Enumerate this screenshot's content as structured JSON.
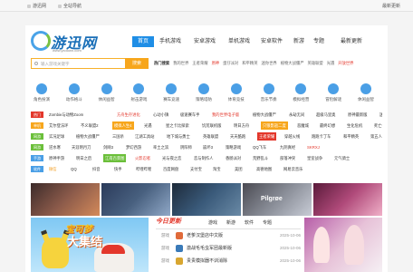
{
  "topbar": {
    "home": "游迅网",
    "nav": "全站导航",
    "fav": "最新更新"
  },
  "logo": {
    "name": "游迅网",
    "url": "www.yxdown.com"
  },
  "nav": [
    {
      "label": "首页",
      "active": true
    },
    {
      "label": "手机游戏"
    },
    {
      "label": "安卓游戏"
    },
    {
      "label": "单机游戏"
    },
    {
      "label": "安卓软件"
    },
    {
      "label": "新游"
    },
    {
      "label": "专题"
    },
    {
      "label": "最新更新"
    }
  ],
  "search": {
    "placeholder": "输入游戏关键字",
    "button": "搜索"
  },
  "hot_search": {
    "label": "热门搜索",
    "items": [
      "我的世界",
      "王者荣耀",
      "原神",
      "蛋仔派对",
      "和平精英",
      "迷你世界",
      "植物大战僵尸",
      "英雄联盟",
      "光遇",
      "开放世界"
    ],
    "highlight": [
      "原神",
      "开放世界"
    ]
  },
  "categories": [
    {
      "label": "角色扮演",
      "color": "#4a9fe6"
    },
    {
      "label": "动作格斗",
      "color": "#4a9fe6"
    },
    {
      "label": "休闲益智",
      "color": "#4a9fe6"
    },
    {
      "label": "射击游戏",
      "color": "#4a9fe6"
    },
    {
      "label": "赛车竞速",
      "color": "#4a9fe6"
    },
    {
      "label": "策略塔防",
      "color": "#4a9fe6"
    },
    {
      "label": "体育竞技",
      "color": "#4a9fe6"
    },
    {
      "label": "音乐节奏",
      "color": "#4a9fe6"
    },
    {
      "label": "模拟经营",
      "color": "#4a9fe6"
    },
    {
      "label": "冒险解谜",
      "color": "#4a9fe6"
    },
    {
      "label": "休闲益智",
      "color": "#4a9fe6"
    }
  ],
  "rows": [
    {
      "tag": "热门",
      "tag_color": "#e3372b",
      "items": [
        {
          "t": "Zombie与动物Zoom"
        },
        {
          "t": "方舟生存进化",
          "c": "red"
        },
        {
          "t": "心动小镇"
        },
        {
          "t": "极速赛车手"
        },
        {
          "t": "我的世界电子版",
          "c": "red"
        },
        {
          "t": "植物大战僵尸"
        },
        {
          "t": "永劫无间"
        },
        {
          "t": "超级马里奥"
        },
        {
          "t": "原神最新版"
        },
        {
          "t": "迷你世界"
        },
        {
          "t": "蛋仔派对"
        }
      ]
    },
    {
      "tag": "单机",
      "tag_color": "#f7a61c",
      "items": [
        {
          "t": "艾尔登法环"
        },
        {
          "t": "不义联盟2"
        },
        {
          "t": "模拟人生4",
          "c": "bgorange"
        },
        {
          "t": "光遇"
        },
        {
          "t": "星之卡比探索"
        },
        {
          "t": "饥荒联机版"
        },
        {
          "t": "明日方舟"
        },
        {
          "t": "只狼影逝二度",
          "c": "bgorange"
        },
        {
          "t": "恶魔城"
        },
        {
          "t": "最终幻想"
        },
        {
          "t": "生化危机"
        },
        {
          "t": "死亡搁浅"
        }
      ]
    },
    {
      "tag": "网游",
      "tag_color": "#6bbf3a",
      "items": [
        {
          "t": "实况足球"
        },
        {
          "t": "植物大战僵尸"
        },
        {
          "t": "三国杀"
        },
        {
          "t": "江湖工具站"
        },
        {
          "t": "地下城与勇士"
        },
        {
          "t": "英雄联盟"
        },
        {
          "t": "天天酷跑"
        },
        {
          "t": "王者荣耀",
          "c": "bgred"
        },
        {
          "t": "穿越火线"
        },
        {
          "t": "跑跑卡丁车"
        },
        {
          "t": "和平精英"
        },
        {
          "t": "第五人格"
        }
      ]
    },
    {
      "tag": "网游",
      "tag_color": "#6bbf3a",
      "items": [
        {
          "t": "逆水寒"
        },
        {
          "t": "天涯明月刀"
        },
        {
          "t": "剑网3"
        },
        {
          "t": "梦幻西游"
        },
        {
          "t": "率土之滨"
        },
        {
          "t": "阴阳师"
        },
        {
          "t": "崩坏3"
        },
        {
          "t": "策略游戏"
        },
        {
          "t": "QQ飞车"
        },
        {
          "t": "九阴真经"
        },
        {
          "t": "SKRXJ",
          "c": "red"
        }
      ]
    },
    {
      "tag": "手游",
      "tag_color": "#4a9fe6",
      "items": [
        {
          "t": "原神手游"
        },
        {
          "t": "明日之后"
        },
        {
          "t": "江南百景图",
          "c": "bggreen"
        },
        {
          "t": "火影忍者",
          "c": "red"
        },
        {
          "t": "光与夜之恋"
        },
        {
          "t": "恋与制作人"
        },
        {
          "t": "香肠派对"
        },
        {
          "t": "荒野乱斗"
        },
        {
          "t": "部落冲突"
        },
        {
          "t": "皇室战争"
        },
        {
          "t": "元气骑士"
        }
      ]
    },
    {
      "tag": "软件",
      "tag_color": "#4a9fe6",
      "items": [
        {
          "t": "微信",
          "c": "orange"
        },
        {
          "t": "QQ"
        },
        {
          "t": "抖音"
        },
        {
          "t": "快手"
        },
        {
          "t": "哔哩哔哩"
        },
        {
          "t": "百度网盘"
        },
        {
          "t": "支付宝"
        },
        {
          "t": "淘宝"
        },
        {
          "t": "美团"
        },
        {
          "t": "高德地图"
        },
        {
          "t": "网易云音乐"
        }
      ]
    }
  ],
  "banners": [
    {
      "label": "",
      "colors": [
        "#3c2b2a",
        "#8b5a4a",
        "#d48a5a"
      ]
    },
    {
      "label": "",
      "colors": [
        "#2a3a5a",
        "#48607f",
        "#90a8c7"
      ]
    },
    {
      "label": "",
      "colors": [
        "#1d2a3a",
        "#3a5a7a",
        "#6a8aa6"
      ]
    },
    {
      "label": "Pilgrøe",
      "colors": [
        "#4a4a52",
        "#888c96",
        "#c8ccd6"
      ]
    },
    {
      "label": "",
      "colors": [
        "#5a1a3a",
        "#b04a7a",
        "#f0b0c8"
      ]
    }
  ],
  "feature": {
    "title1": "宝可梦",
    "title2": "大集结"
  },
  "today": {
    "brand": "今日更新",
    "tabs": [
      "游戏",
      "新游",
      "软件",
      "专题"
    ],
    "items": [
      {
        "cat": "游戏",
        "title": "老爹汉堡店中文版",
        "date": "2025-10-06",
        "thumb": "#e06a3a"
      },
      {
        "cat": "游戏",
        "title": "激战毛毛虫军团最新版",
        "date": "2025-10-06",
        "thumb": "#3a7ab8"
      },
      {
        "cat": "游戏",
        "title": "贵贵模拟器不训消除",
        "date": "2025-10-06",
        "thumb": "#d8a630"
      }
    ]
  }
}
